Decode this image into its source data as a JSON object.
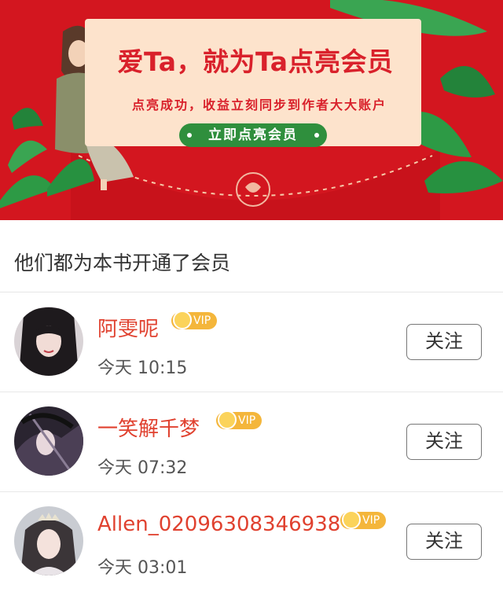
{
  "banner": {
    "title": "爱Ta，就为Ta点亮会员",
    "subtitle": "点亮成功，收益立刻同步到作者大大账户",
    "cta_label": "立即点亮会员"
  },
  "section": {
    "title": "他们都为本书开通了会员"
  },
  "members": [
    {
      "name": "阿雯呢",
      "badge": "VIP",
      "time": "今天 10:15",
      "follow_label": "关注"
    },
    {
      "name": "一笑解千梦",
      "badge": "VIP",
      "time": "今天 07:32",
      "follow_label": "关注"
    },
    {
      "name": "Allen_02096308346938",
      "badge": "VIP",
      "time": "今天 03:01",
      "follow_label": "关注"
    }
  ],
  "colors": {
    "banner_red": "#d3161f",
    "name_red": "#e0412f",
    "cta_green": "#2f8f3d",
    "vip_gold": "#f4b63b"
  }
}
